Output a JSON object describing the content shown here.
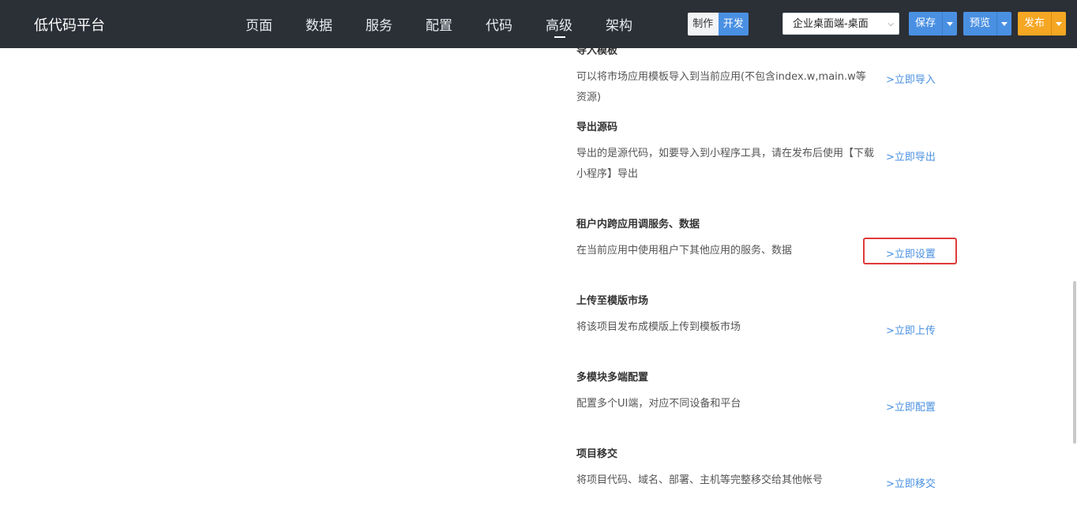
{
  "header": {
    "brand": "低代码平台",
    "nav": [
      {
        "label": "页面"
      },
      {
        "label": "数据"
      },
      {
        "label": "服务"
      },
      {
        "label": "配置"
      },
      {
        "label": "代码"
      },
      {
        "label": "高级",
        "active": true
      },
      {
        "label": "架构"
      }
    ],
    "mode": {
      "make_label": "制作",
      "dev_label": "开发",
      "selected": "开发"
    },
    "terminal_select": {
      "value": "企业桌面端-桌面"
    },
    "save_label": "保存",
    "preview_label": "预览",
    "publish_label": "发布",
    "colors": {
      "bar": "#2b2f36",
      "primary": "#4a90e2",
      "publish": "#f5a623"
    }
  },
  "sections": [
    {
      "title": "导入模板",
      "desc": "可以将市场应用模板导入到当前应用(不包含index.w,main.w等资源)",
      "link": ">立即导入"
    },
    {
      "title": "导出源码",
      "desc": "导出的是源代码，如要导入到小程序工具，请在发布后使用【下载小程序】导出",
      "link": ">立即导出"
    },
    {
      "title": "租户内跨应用调服务、数据",
      "desc": "在当前应用中使用租户下其他应用的服务、数据",
      "link": ">立即设置",
      "highlighted": true
    },
    {
      "title": "上传至模版市场",
      "desc": "将该项目发布成模版上传到模板市场",
      "link": ">立即上传"
    },
    {
      "title": "多模块多端配置",
      "desc": "配置多个UI端，对应不同设备和平台",
      "link": ">立即配置"
    },
    {
      "title": "项目移交",
      "desc": "将项目代码、域名、部署、主机等完整移交给其他帐号",
      "link": ">立即移交"
    }
  ],
  "colors": {
    "link": "#4a90e2",
    "highlight": "#e03a3a"
  }
}
